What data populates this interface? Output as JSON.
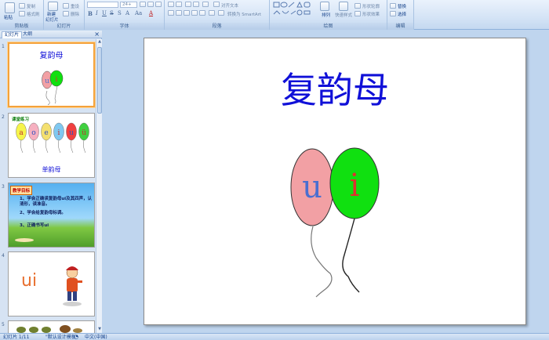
{
  "ribbon": {
    "groups": [
      {
        "name": "clipboard",
        "label": "剪贴板",
        "paste": "粘贴",
        "copy": "复制",
        "format_painter": "格式刷"
      },
      {
        "name": "slides",
        "label": "幻灯片",
        "new_slide": "新建",
        "new_slide_sub": "幻灯片",
        "reset": "重设",
        "delete": "删除"
      },
      {
        "name": "font",
        "label": "字体",
        "font_size": "24+"
      },
      {
        "name": "paragraph",
        "label": "段落",
        "align_text": "对齐文本",
        "convert_smartart": "转换为 SmartArt"
      },
      {
        "name": "drawing",
        "label": "绘图",
        "arrange": "排列",
        "quick_styles": "快速样式",
        "shape_fill": "形状轮廓",
        "shape_effects": "形状效果"
      },
      {
        "name": "editing",
        "label": "编辑",
        "replace": "替换",
        "select": "选择"
      }
    ]
  },
  "left_pane": {
    "tabs": [
      "幻灯片",
      "大纲"
    ],
    "close": "×",
    "thumbnails": [
      {
        "num": "1",
        "title": "复韵母",
        "balloon_left": "u",
        "balloon_right": "i"
      },
      {
        "num": "2",
        "header": "课堂练习",
        "letters": [
          "a",
          "o",
          "e",
          "i",
          "u",
          "ü"
        ],
        "caption": "单韵母"
      },
      {
        "num": "3",
        "badge": "教学目标",
        "lines": [
          "1、学会正确读复韵母ui及其四声，认清形，读准音。",
          "2、学会给复韵母标调。",
          "3、正确书写ui"
        ]
      },
      {
        "num": "4",
        "text": "ui"
      },
      {
        "num": "5"
      }
    ]
  },
  "slide": {
    "title": "复韵母",
    "balloon_left_letter": "u",
    "balloon_right_letter": "i",
    "colors": {
      "title": "#1010d8",
      "balloon_left": "#f2a0a4",
      "balloon_right": "#10e010",
      "letter_left": "#4a6fd0",
      "letter_right": "#e03030"
    }
  },
  "status": {
    "slide_info": "幻灯片 1/11",
    "theme": "\"默认设计模板\"",
    "language": "中文(中国)"
  }
}
